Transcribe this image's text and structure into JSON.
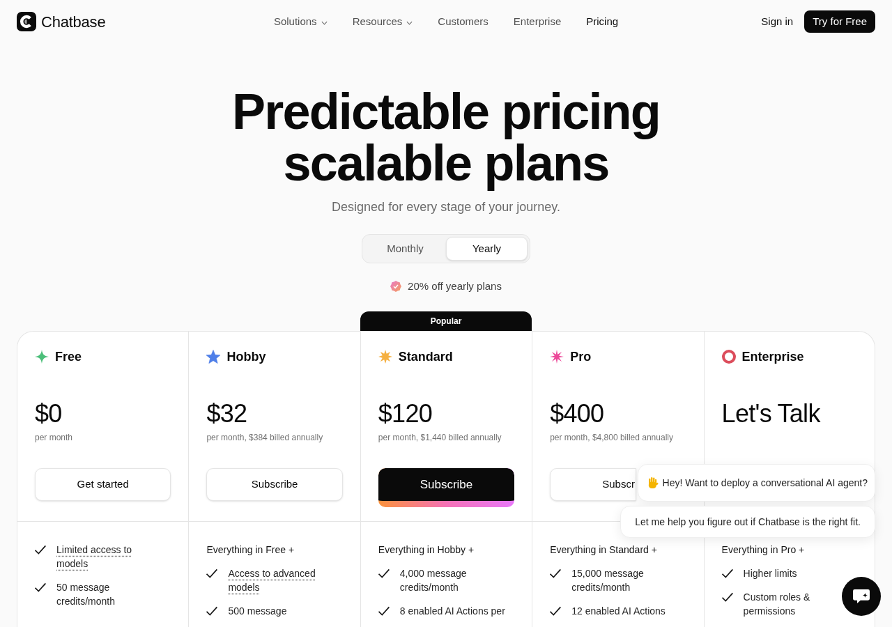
{
  "header": {
    "brand": "Chatbase",
    "nav": [
      {
        "label": "Solutions",
        "dropdown": true,
        "selected": false
      },
      {
        "label": "Resources",
        "dropdown": true,
        "selected": false
      },
      {
        "label": "Customers",
        "dropdown": false,
        "selected": false
      },
      {
        "label": "Enterprise",
        "dropdown": false,
        "selected": false
      },
      {
        "label": "Pricing",
        "dropdown": false,
        "selected": true
      }
    ],
    "sign_in": "Sign in",
    "cta": "Try for Free"
  },
  "hero": {
    "title": "Predictable pricing scalable plans",
    "subtitle": "Designed for every stage of your journey."
  },
  "billing_toggle": [
    {
      "label": "Monthly",
      "selected": false
    },
    {
      "label": "Yearly",
      "selected": true
    }
  ],
  "discount_note": "20% off yearly plans",
  "plans": [
    {
      "name": "Free",
      "color": "#4cbf7a",
      "price": "$0",
      "price_note": "per month",
      "button": {
        "label": "Get started",
        "kind": "outline"
      },
      "features": [
        {
          "text": "Limited access to models",
          "underlined": true
        },
        {
          "text": "50 message credits/month",
          "underlined": false
        }
      ]
    },
    {
      "name": "Hobby",
      "color": "#4f7fe8",
      "price": "$32",
      "price_note": "per month, $384 billed annually",
      "button": {
        "label": "Subscribe",
        "kind": "outline"
      },
      "features_heading": "Everything in Free +",
      "features": [
        {
          "text": "Access to advanced models",
          "underlined": true
        },
        {
          "text": "500 message",
          "underlined": false
        }
      ]
    },
    {
      "name": "Standard",
      "color": "#f5b041",
      "badge": "Popular",
      "price": "$120",
      "price_note": "per month, $1,440 billed annually",
      "button": {
        "label": "Subscribe",
        "kind": "primary"
      },
      "features_heading": "Everything in Hobby +",
      "features": [
        {
          "text": "4,000 message credits/month",
          "underlined": false
        },
        {
          "text": "8 enabled AI Actions per",
          "underlined": false
        }
      ]
    },
    {
      "name": "Pro",
      "color": "#ec4899",
      "price": "$400",
      "price_note": "per month, $4,800 billed annually",
      "button": {
        "label": "Subscr",
        "kind": "outline"
      },
      "features_heading": "Everything in Standard +",
      "features": [
        {
          "text": "15,000 message credits/month",
          "underlined": false
        },
        {
          "text": "12 enabled AI Actions",
          "underlined": false
        }
      ]
    },
    {
      "name": "Enterprise",
      "color": "#dc4d5c",
      "price": "Let's Talk",
      "features_heading": "Everything in Pro +",
      "features": [
        {
          "text": "Higher limits",
          "underlined": false
        },
        {
          "text": "Custom roles & permissions",
          "underlined": false
        }
      ]
    }
  ],
  "chat_widget": {
    "messages": [
      {
        "kind": "greeting",
        "text": "Hey! Want to deploy a conversational AI agent?"
      },
      {
        "kind": "text",
        "text": "Let me help you figure out if Chatbase is the right fit."
      }
    ]
  }
}
